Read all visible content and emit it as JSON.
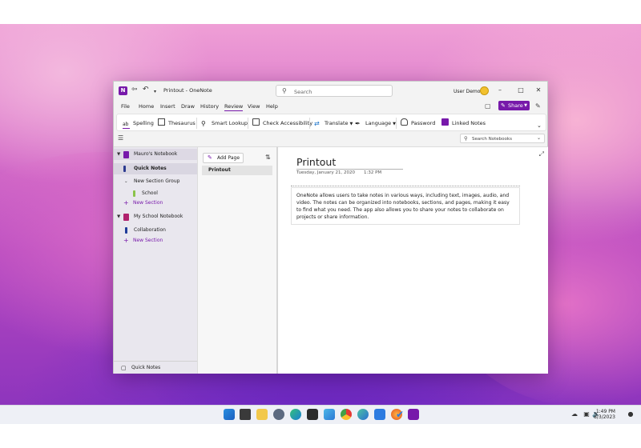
{
  "window": {
    "title": "Printout  -  OneNote",
    "search_placeholder": "Search",
    "user_name": "User Demo"
  },
  "menu": [
    "File",
    "Home",
    "Insert",
    "Draw",
    "History",
    "Review",
    "View",
    "Help"
  ],
  "menu_active": "Review",
  "share_label": "Share",
  "ribbon": {
    "spelling": "Spelling",
    "thesaurus": "Thesaurus",
    "smart_lookup": "Smart Lookup",
    "check_accessibility": "Check Accessibility",
    "translate": "Translate",
    "language": "Language",
    "password": "Password",
    "linked_notes": "Linked Notes"
  },
  "search_notebooks": "Search Notebooks",
  "nav": {
    "notebook1": "Mauro's Notebook",
    "quick_notes": "Quick Notes",
    "section_group": "New Section Group",
    "school": "School",
    "new_section_1": "New Section",
    "notebook2": "My School Notebook",
    "collaboration": "Collaboration",
    "new_section_2": "New Section",
    "footer": "Quick Notes"
  },
  "pages": {
    "add_page": "Add Page",
    "items": [
      "Printout"
    ]
  },
  "page": {
    "title": "Printout",
    "date": "Tuesday, January 21, 2020",
    "time": "1:32 PM",
    "body": "OneNote allows users to take notes in various ways, including text, images, audio, and video. The notes can be organized into notebooks, sections, and pages, making it easy to find what you need. The app also allows you to share your notes to collaborate on projects or share information."
  },
  "taskbar": {
    "time": "1:49 PM",
    "date": "8/3/2023"
  },
  "colors": {
    "accent": "#7719aa",
    "notebook1": "#7719aa",
    "notebook2": "#b0216d",
    "school_section": "#8bc34a",
    "collaboration_section": "#1f3c99",
    "quick_notes_section": "#2b3a8f"
  },
  "icons": [
    "onenote-app-icon",
    "back-icon",
    "undo-icon",
    "search-icon",
    "avatar",
    "share-icon",
    "spelling-icon",
    "thesaurus-icon",
    "smart-lookup-icon",
    "accessibility-icon",
    "translate-icon",
    "language-icon",
    "password-icon",
    "linked-notes-icon",
    "notebook-icon",
    "sort-icon",
    "expand-icon"
  ]
}
